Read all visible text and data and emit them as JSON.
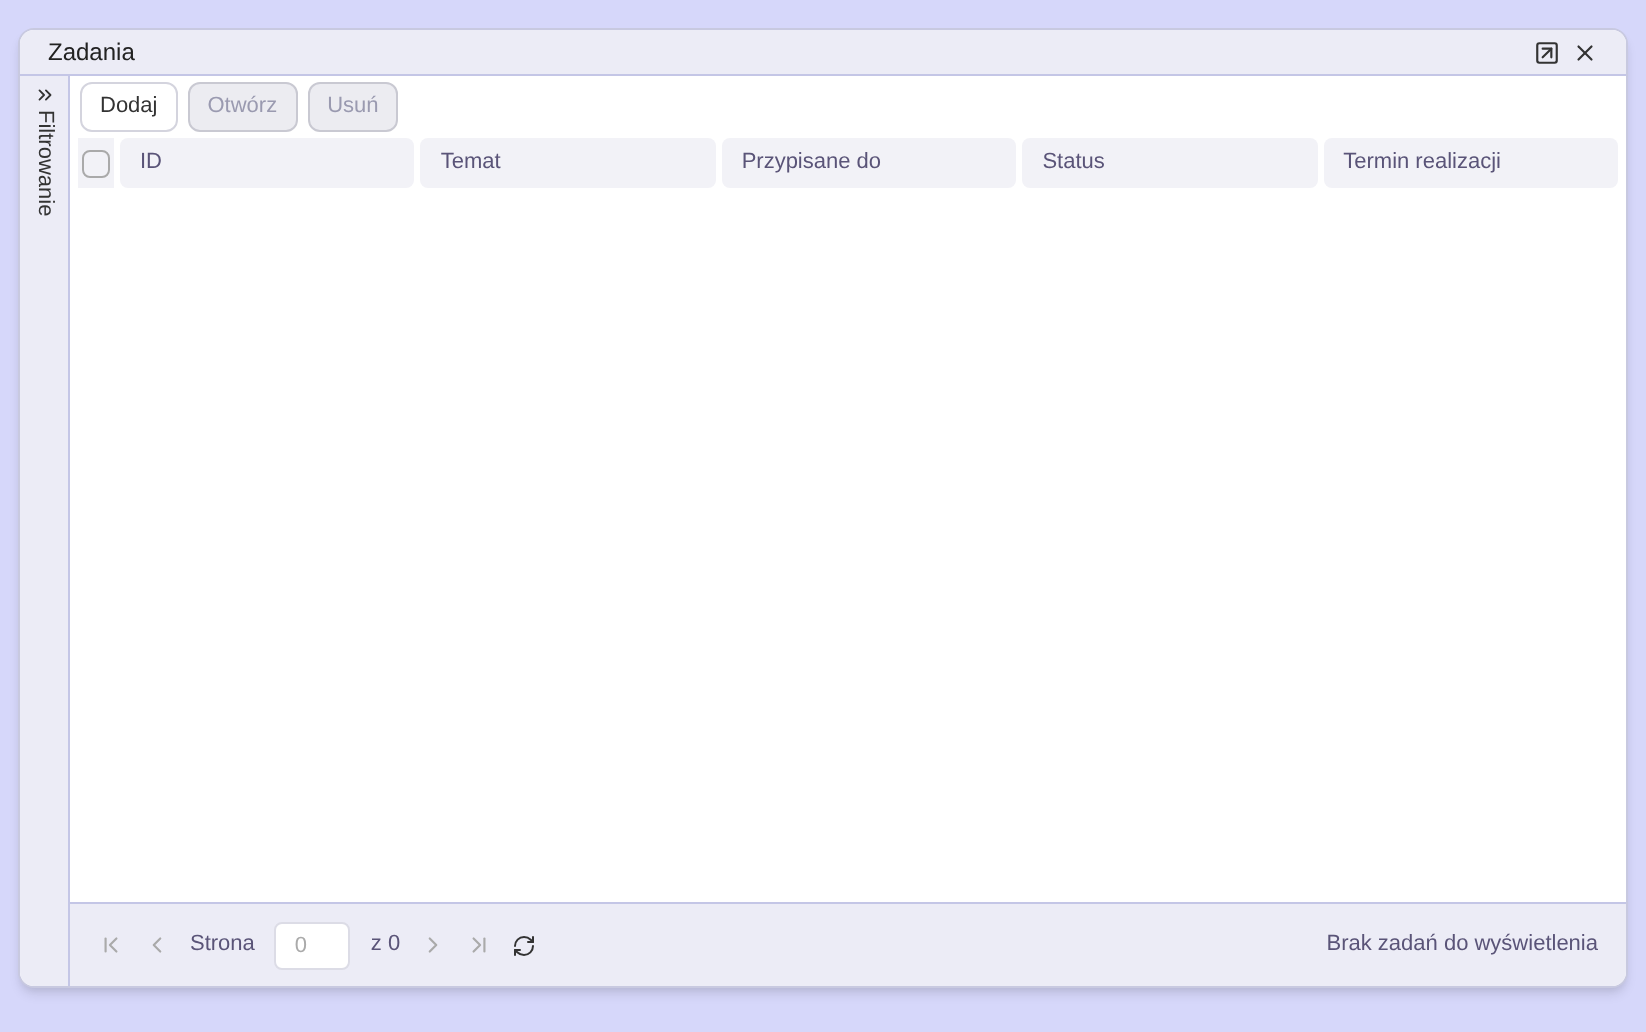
{
  "window": {
    "title": "Zadania"
  },
  "filter_panel": {
    "label": "Filtrowanie",
    "expanded": false
  },
  "toolbar": [
    {
      "label": "Dodaj",
      "disabled": false
    },
    {
      "label": "Otwórz",
      "disabled": true
    },
    {
      "label": "Usuń",
      "disabled": true
    }
  ],
  "table": {
    "select_all": {
      "checked": false
    },
    "columns": [
      "ID",
      "Temat",
      "Przypisane do",
      "Status",
      "Termin realizacji"
    ]
  },
  "pager": {
    "page_label": "Strona",
    "page_value": "0",
    "of_label": "z 0"
  },
  "status_text": "Brak zadań do wyświetlenia"
}
